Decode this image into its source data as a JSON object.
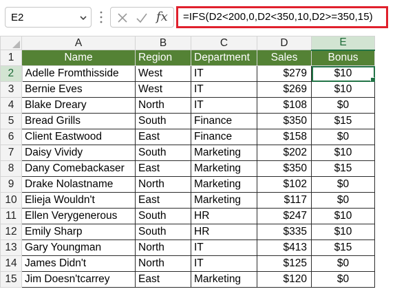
{
  "name_box": {
    "value": "E2"
  },
  "formula_bar": {
    "cancel_icon": "x-icon",
    "enter_icon": "check-icon",
    "function_label": "fx",
    "formula": "=IFS(D2<200,0,D2<350,10,D2>=350,15)",
    "highlight_color": "#e0202c"
  },
  "sheet": {
    "columns": [
      "A",
      "B",
      "C",
      "D",
      "E"
    ],
    "selected_column": "E",
    "selected_row": "2",
    "header_fill_color": "#548235",
    "active_cell": "E2",
    "header_row": {
      "row_number": "1",
      "cells": [
        "Name",
        "Region",
        "Department",
        "Sales",
        "Bonus"
      ]
    },
    "rows": [
      {
        "n": "2",
        "name": "Adelle Fromthisside",
        "region": "West",
        "dept": "IT",
        "sales": "$279",
        "bonus": "$10"
      },
      {
        "n": "3",
        "name": "Bernie Eves",
        "region": "West",
        "dept": "IT",
        "sales": "$269",
        "bonus": "$10"
      },
      {
        "n": "4",
        "name": "Blake Dreary",
        "region": "North",
        "dept": "IT",
        "sales": "$108",
        "bonus": "$0"
      },
      {
        "n": "5",
        "name": "Bread Grills",
        "region": "South",
        "dept": "Finance",
        "sales": "$350",
        "bonus": "$15"
      },
      {
        "n": "6",
        "name": "Client Eastwood",
        "region": "East",
        "dept": "Finance",
        "sales": "$158",
        "bonus": "$0"
      },
      {
        "n": "7",
        "name": "Daisy Vividy",
        "region": "South",
        "dept": "Marketing",
        "sales": "$202",
        "bonus": "$10"
      },
      {
        "n": "8",
        "name": "Dany Comebackaser",
        "region": "East",
        "dept": "Marketing",
        "sales": "$350",
        "bonus": "$15"
      },
      {
        "n": "9",
        "name": "Drake Nolastname",
        "region": "North",
        "dept": "Marketing",
        "sales": "$102",
        "bonus": "$0"
      },
      {
        "n": "10",
        "name": "Elieja Wouldn't",
        "region": "East",
        "dept": "Marketing",
        "sales": "$117",
        "bonus": "$0"
      },
      {
        "n": "11",
        "name": "Ellen Verygenerous",
        "region": "South",
        "dept": "HR",
        "sales": "$247",
        "bonus": "$10"
      },
      {
        "n": "12",
        "name": "Emily Sharp",
        "region": "South",
        "dept": "HR",
        "sales": "$335",
        "bonus": "$10"
      },
      {
        "n": "13",
        "name": "Gary Youngman",
        "region": "North",
        "dept": "IT",
        "sales": "$413",
        "bonus": "$15"
      },
      {
        "n": "14",
        "name": "James Didn't",
        "region": "North",
        "dept": "IT",
        "sales": "$125",
        "bonus": "$0"
      },
      {
        "n": "15",
        "name": "Jim Doesn'tcarrey",
        "region": "East",
        "dept": "Marketing",
        "sales": "$120",
        "bonus": "$0"
      }
    ]
  }
}
